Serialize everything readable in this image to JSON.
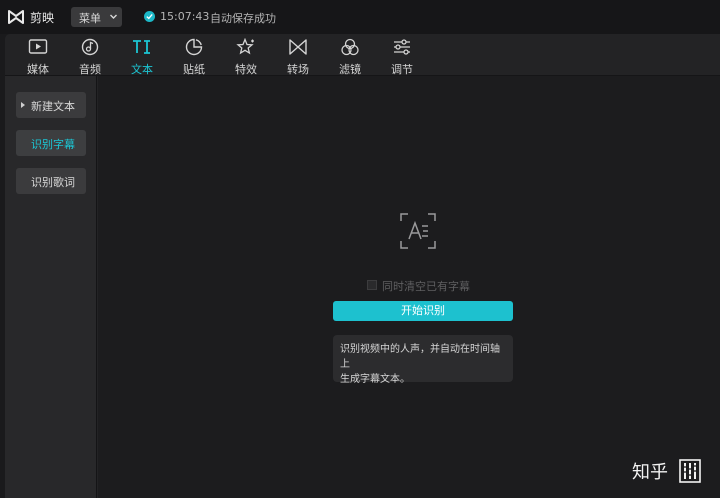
{
  "app": {
    "name": "剪映",
    "logo_icon": "capcut-logo-icon"
  },
  "menu": {
    "label": "菜单"
  },
  "save_status": {
    "time": "15:07:43",
    "text": "自动保存成功",
    "accent": "#1cb8c8"
  },
  "toolbar": {
    "items": [
      {
        "label": "媒体",
        "icon": "media-icon"
      },
      {
        "label": "音频",
        "icon": "audio-icon"
      },
      {
        "label": "文本",
        "icon": "text-icon",
        "active": true
      },
      {
        "label": "贴纸",
        "icon": "sticker-icon"
      },
      {
        "label": "特效",
        "icon": "effects-icon"
      },
      {
        "label": "转场",
        "icon": "transition-icon"
      },
      {
        "label": "滤镜",
        "icon": "filter-icon"
      },
      {
        "label": "调节",
        "icon": "adjust-icon"
      }
    ],
    "active_color": "#1cc6d4"
  },
  "sidebar": {
    "items": [
      {
        "label": "新建文本",
        "expandable": true
      },
      {
        "label": "识别字幕",
        "active": true
      },
      {
        "label": "识别歌词"
      }
    ]
  },
  "recognize": {
    "checkbox_label": "同时清空已有字幕",
    "checkbox_checked": false,
    "button_label": "开始识别",
    "button_color": "#1dc1cf",
    "hint_line1": "识别视频中的人声，并自动在时间轴上",
    "hint_line2": "生成字幕文本。"
  },
  "watermark": {
    "text": "知乎",
    "seal_text": "知乎@"
  }
}
